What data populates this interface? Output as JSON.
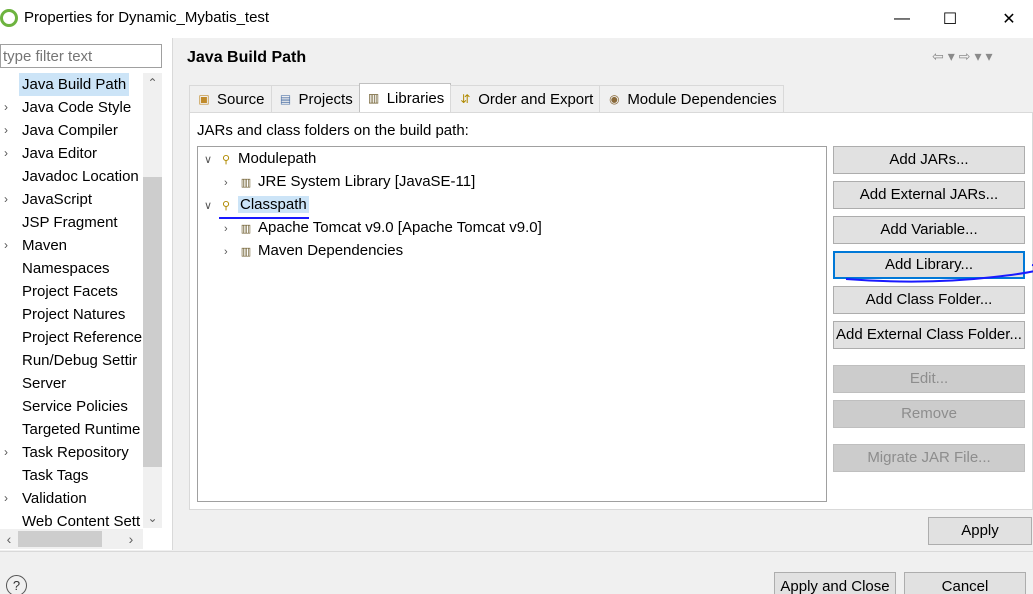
{
  "window": {
    "title": "Properties for Dynamic_Mybatis_test",
    "minimize": "—",
    "maximize": "☐",
    "close": "✕"
  },
  "sidebar": {
    "filter_placeholder": "type filter text",
    "items": [
      {
        "label": "Java Build Path",
        "expandable": false,
        "selected": true
      },
      {
        "label": "Java Code Style",
        "expandable": true
      },
      {
        "label": "Java Compiler",
        "expandable": true
      },
      {
        "label": "Java Editor",
        "expandable": true
      },
      {
        "label": "Javadoc Location",
        "expandable": false
      },
      {
        "label": "JavaScript",
        "expandable": true
      },
      {
        "label": "JSP Fragment",
        "expandable": false
      },
      {
        "label": "Maven",
        "expandable": true
      },
      {
        "label": "Namespaces",
        "expandable": false
      },
      {
        "label": "Project Facets",
        "expandable": false
      },
      {
        "label": "Project Natures",
        "expandable": false
      },
      {
        "label": "Project Reference",
        "expandable": false
      },
      {
        "label": "Run/Debug Settir",
        "expandable": false
      },
      {
        "label": "Server",
        "expandable": false
      },
      {
        "label": "Service Policies",
        "expandable": false
      },
      {
        "label": "Targeted Runtime",
        "expandable": false
      },
      {
        "label": "Task Repository",
        "expandable": true
      },
      {
        "label": "Task Tags",
        "expandable": false
      },
      {
        "label": "Validation",
        "expandable": true
      },
      {
        "label": "Web Content Sett",
        "expandable": false
      }
    ]
  },
  "main": {
    "title": "Java Build Path",
    "tabs": [
      {
        "label": "Source",
        "icon": "source-folder-icon",
        "active": false
      },
      {
        "label": "Projects",
        "icon": "projects-icon",
        "active": false
      },
      {
        "label": "Libraries",
        "icon": "libraries-icon",
        "active": true
      },
      {
        "label": "Order and Export",
        "icon": "order-export-icon",
        "active": false
      },
      {
        "label": "Module Dependencies",
        "icon": "module-dependencies-icon",
        "active": false
      }
    ],
    "path_label": "JARs and class folders on the build path:",
    "tree": {
      "modulepath": "Modulepath",
      "jre": "JRE System Library [JavaSE-11]",
      "classpath": "Classpath",
      "tomcat": "Apache Tomcat v9.0 [Apache Tomcat v9.0]",
      "maven": "Maven Dependencies"
    },
    "buttons": {
      "add_jars": "Add JARs...",
      "add_external_jars": "Add External JARs...",
      "add_variable": "Add Variable...",
      "add_library": "Add Library...",
      "add_class_folder": "Add Class Folder...",
      "add_external_class_folder": "Add External Class Folder...",
      "edit": "Edit...",
      "remove": "Remove",
      "migrate": "Migrate JAR File..."
    },
    "apply": "Apply"
  },
  "footer": {
    "help": "?",
    "apply_and_close": "Apply and Close",
    "cancel": "Cancel"
  },
  "colors": {
    "accent": "#0078d7",
    "annotation": "#1a1aff",
    "selection": "#cce4f7"
  }
}
